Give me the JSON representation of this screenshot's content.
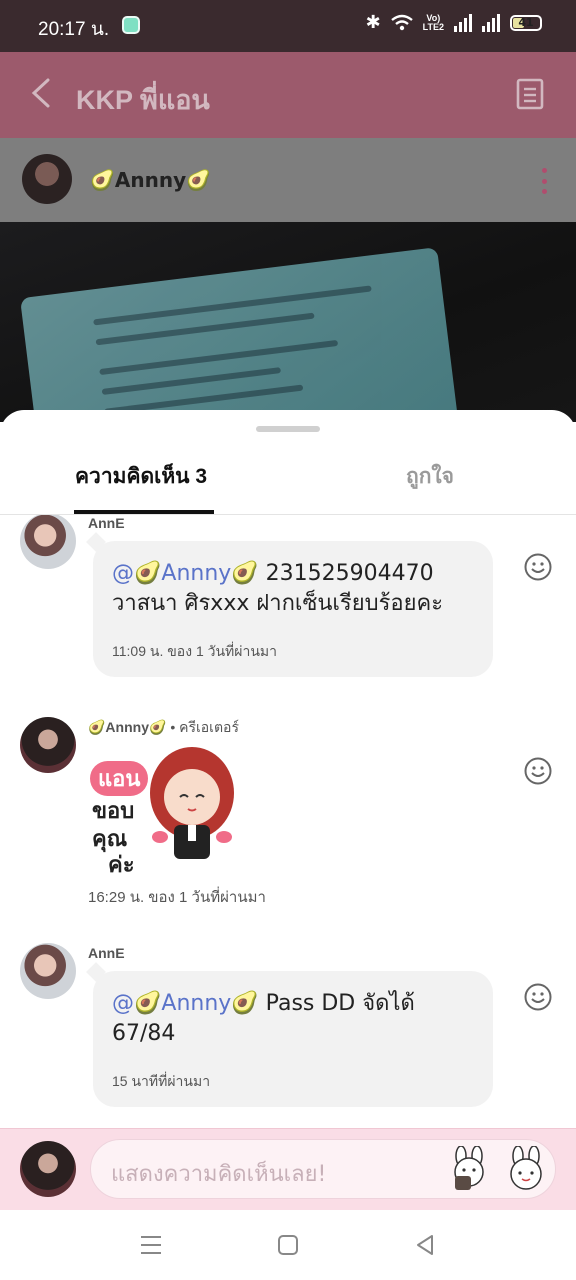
{
  "status_bar": {
    "time": "20:17 น.",
    "volte_top": "Vo)",
    "volte_bottom": "LTE2",
    "battery": "41"
  },
  "header": {
    "title": "KKP พี่แอน",
    "back_icon": "chevron-left-icon",
    "menu_icon": "document-icon"
  },
  "post": {
    "author": "🥑Annny🥑"
  },
  "sheet": {
    "tabs": [
      {
        "label": "ความคิดเห็น 3",
        "active": true
      },
      {
        "label": "ถูกใจ",
        "active": false
      }
    ]
  },
  "comments": [
    {
      "author": "AnnE",
      "mention": "@🥑Annny🥑",
      "text_line1": " 231525904470",
      "text_line2": "วาสนา ศิรxxx ฝากเซ็นเรียบร้อยคะ",
      "time": "11:09 น. ของ 1 วันที่ผ่านมา"
    },
    {
      "author": "🥑Annny🥑",
      "creator_tag": "• ครีเอเตอร์",
      "sticker": {
        "badge": "แอน",
        "line1": "ขอบ",
        "line2": "คุณ",
        "line3": "ค่ะ"
      },
      "time": "16:29 น. ของ 1 วันที่ผ่านมา"
    },
    {
      "author": "AnnE",
      "mention": "@🥑Annny🥑",
      "text_line1": " Pass DD จัดได้",
      "text_line2": "67/84",
      "time": "15 นาทีที่ผ่านมา"
    }
  ],
  "input": {
    "placeholder": "แสดงความคิดเห็นเลย!"
  },
  "colors": {
    "accent": "#b04d6e",
    "mention": "#5a73c9",
    "input_bar": "#fadde6"
  }
}
